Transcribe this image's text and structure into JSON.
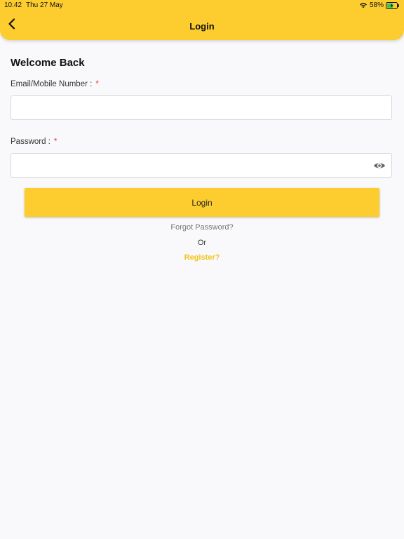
{
  "status_bar": {
    "time": "10:42",
    "date": "Thu 27 May",
    "battery": "58%"
  },
  "header": {
    "title": "Login",
    "background": "#fdcd30"
  },
  "form": {
    "heading": "Welcome Back",
    "email_label": "Email/Mobile Number :",
    "email_required": "*",
    "email_value": "",
    "password_label": "Password :",
    "password_required": "*",
    "password_value": "",
    "login_button": "Login",
    "forgot_link": "Forgot Password?",
    "or_text": "Or",
    "register_link": "Register?"
  },
  "icons": {
    "back": "chevron-left-icon",
    "show_password": "eye-icon",
    "wifi": "wifi-icon",
    "battery": "battery-charging-icon"
  },
  "colors": {
    "accent": "#fdcd30",
    "required": "#e53935",
    "register": "#f0c419"
  }
}
